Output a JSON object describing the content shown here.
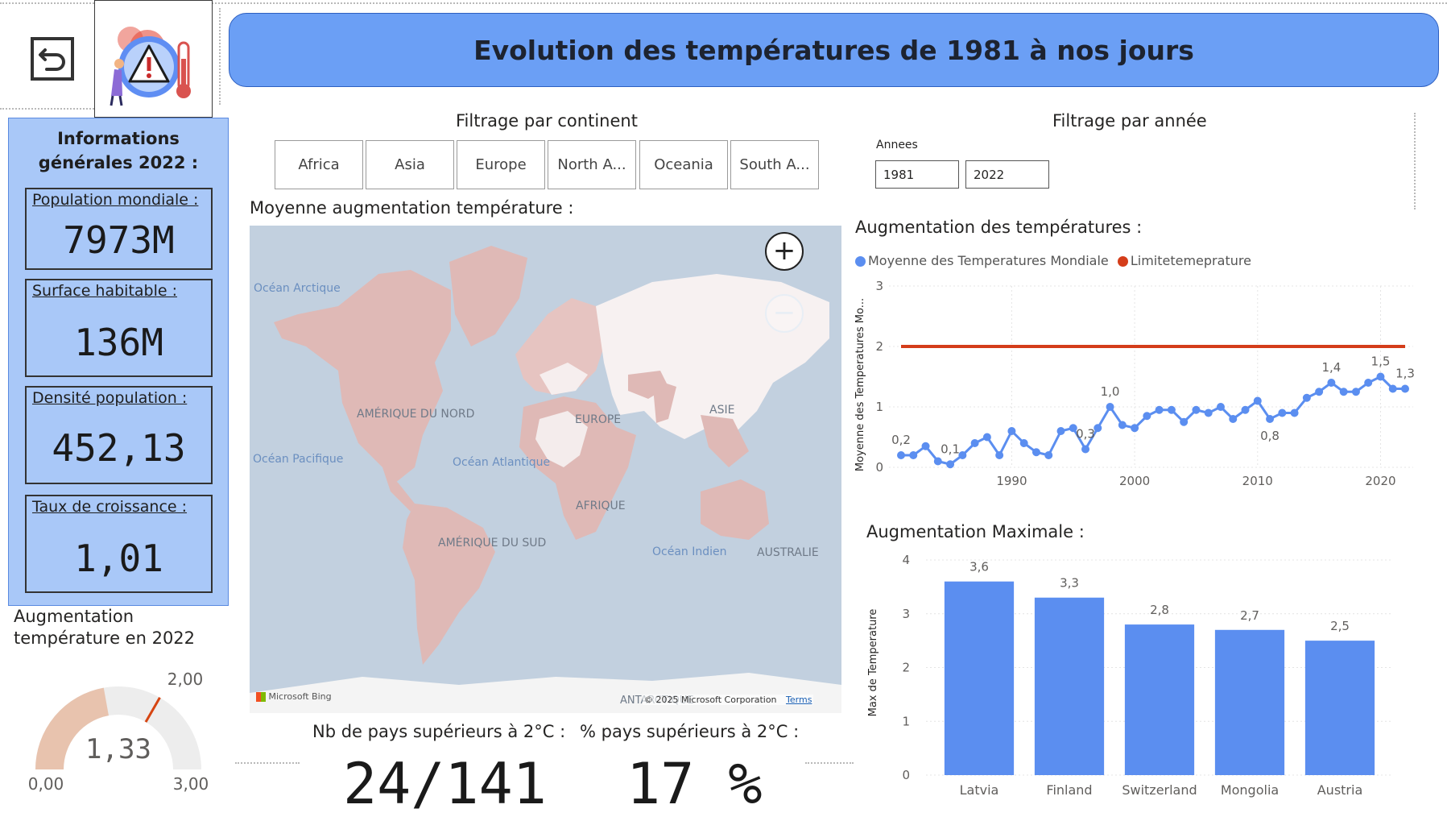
{
  "header": {
    "title": "Evolution des températures de 1981 à nos jours"
  },
  "icons": {
    "back": "back-arrow-icon",
    "logo": "warning-thermometer-icon"
  },
  "info_panel": {
    "title_line1": "Informations",
    "title_line2": "générales 2022 :",
    "cards": [
      {
        "label": "Population mondiale :",
        "value": "7973M"
      },
      {
        "label": "Surface habitable :",
        "value": "136M"
      },
      {
        "label": "Densité population :",
        "value": "452,13"
      },
      {
        "label": "Taux de croissance :",
        "value": "1,01"
      }
    ]
  },
  "gauge": {
    "title_line1": "Augmentation",
    "title_line2": "température en 2022",
    "value": 1.33,
    "value_label": "1,33",
    "min_label": "0,00",
    "max_label": "3,00",
    "target_label": "2,00",
    "min": 0,
    "max": 3,
    "target": 2,
    "fill_color": "#e8c3ae",
    "track_color": "#ededed",
    "target_color": "#d64512"
  },
  "continent_filter": {
    "title": "Filtrage par continent",
    "options": [
      "Africa",
      "Asia",
      "Europe",
      "North A...",
      "Oceania",
      "South A..."
    ]
  },
  "year_filter": {
    "title": "Filtrage par année",
    "label": "Annees",
    "start": "1981",
    "end": "2022"
  },
  "map": {
    "title": "Moyenne augmentation température :",
    "labels": {
      "arctic": "Océan Arctique",
      "north_america": "AMÉRIQUE DU NORD",
      "europe": "EUROPE",
      "asia": "ASIE",
      "pacific": "Océan Pacifique",
      "atlantic": "Océan Atlantique",
      "africa": "AFRIQUE",
      "south_america": "AMÉRIQUE DU SUD",
      "indian": "Océan Indien",
      "australia": "AUSTRALIE",
      "antarctica": "ANTARCTIQUE"
    },
    "attribution_bing": "Microsoft Bing",
    "copyright": "© 2025 Microsoft Corporation",
    "terms": "Terms",
    "zoom_in": "+",
    "zoom_out": "−"
  },
  "bottom_kpis": {
    "count_label": "Nb de pays supérieurs à 2°C :",
    "count_value": "24/141",
    "pct_label": "% pays supérieurs à 2°C :",
    "pct_value": "17 %"
  },
  "colors": {
    "accent": "#6b9ff5",
    "panel": "#a9c8f8",
    "series_blue": "#5b8ef0",
    "limit_red": "#d43d1a",
    "bar_blue": "#5b8ef0"
  },
  "chart_data": [
    {
      "type": "line",
      "title": "Augmentation des températures :",
      "ylabel": "Moyenne des Temperatures Mo...",
      "xlabel": "",
      "ylim": [
        0,
        3
      ],
      "xlim": [
        1981,
        2022
      ],
      "yticks": [
        "0",
        "1",
        "2",
        "3"
      ],
      "xticks": [
        1990,
        2000,
        2010,
        2020
      ],
      "legend_position": "top-left",
      "grid": true,
      "series": [
        {
          "name": "Moyenne des Temperatures Mondiale",
          "color": "#5b8ef0",
          "x": [
            1981,
            1982,
            1983,
            1984,
            1985,
            1986,
            1987,
            1988,
            1989,
            1990,
            1991,
            1992,
            1993,
            1994,
            1995,
            1996,
            1997,
            1998,
            1999,
            2000,
            2001,
            2002,
            2003,
            2004,
            2005,
            2006,
            2007,
            2008,
            2009,
            2010,
            2011,
            2012,
            2013,
            2014,
            2015,
            2016,
            2017,
            2018,
            2019,
            2020,
            2021,
            2022
          ],
          "values": [
            0.2,
            0.2,
            0.35,
            0.1,
            0.05,
            0.2,
            0.4,
            0.5,
            0.2,
            0.6,
            0.4,
            0.25,
            0.2,
            0.6,
            0.65,
            0.3,
            0.65,
            1.0,
            0.7,
            0.65,
            0.85,
            0.95,
            0.95,
            0.75,
            0.95,
            0.9,
            1.0,
            0.8,
            0.95,
            1.1,
            0.8,
            0.9,
            0.9,
            1.15,
            1.25,
            1.4,
            1.25,
            1.25,
            1.4,
            1.5,
            1.3,
            1.3
          ]
        },
        {
          "name": "Limitetemeprature",
          "color": "#d43d1a",
          "x": [
            1981,
            2022
          ],
          "values": [
            2,
            2
          ]
        }
      ],
      "data_labels": [
        {
          "x": 1981,
          "y": 0.2,
          "label": "0,2"
        },
        {
          "x": 1985,
          "y": 0.05,
          "label": "0,1"
        },
        {
          "x": 1996,
          "y": 0.3,
          "label": "0,3"
        },
        {
          "x": 1998,
          "y": 1.0,
          "label": "1,0"
        },
        {
          "x": 2011,
          "y": 0.8,
          "label": "0,8"
        },
        {
          "x": 2016,
          "y": 1.4,
          "label": "1,4"
        },
        {
          "x": 2020,
          "y": 1.5,
          "label": "1,5"
        },
        {
          "x": 2022,
          "y": 1.3,
          "label": "1,3"
        }
      ]
    },
    {
      "type": "bar",
      "title": "Augmentation Maximale :",
      "ylabel": "Max de Temperature",
      "xlabel": "",
      "ylim": [
        0,
        4
      ],
      "yticks": [
        "0",
        "1",
        "2",
        "3",
        "4"
      ],
      "grid": true,
      "categories": [
        "Latvia",
        "Finland",
        "Switzerland",
        "Mongolia",
        "Austria"
      ],
      "values": [
        3.6,
        3.3,
        2.8,
        2.7,
        2.5
      ],
      "value_labels": [
        "3,6",
        "3,3",
        "2,8",
        "2,7",
        "2,5"
      ],
      "color": "#5b8ef0"
    }
  ]
}
